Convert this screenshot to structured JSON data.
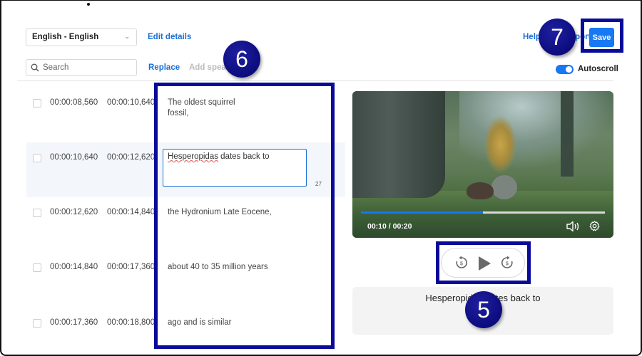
{
  "toolbar": {
    "language_select": {
      "value": "English - English",
      "icon": "chevron-down-icon"
    },
    "edit_details_label": "Edit details",
    "help_label": "Help",
    "export_label": "Export",
    "save_label": "Save",
    "search": {
      "placeholder": "Search",
      "value": "",
      "icon": "search-icon"
    },
    "replace_label": "Replace",
    "add_speaker_label": "Add speaker",
    "autoscroll": {
      "label": "Autoscroll",
      "enabled": true
    }
  },
  "captions": [
    {
      "start": "00:00:08,560",
      "end": "00:00:10,640",
      "text_line1": "The oldest squirrel",
      "text_line2": "fossil,"
    },
    {
      "start": "00:00:10,640",
      "end": "00:00:12,620",
      "text": "Hesperopidas dates back to",
      "char_count": "27",
      "editing": true
    },
    {
      "start": "00:00:12,620",
      "end": "00:00:14,840",
      "text": "the Hydronium Late Eocene,"
    },
    {
      "start": "00:00:14,840",
      "end": "00:00:17,360",
      "text": "about 40 to 35 million years"
    },
    {
      "start": "00:00:17,360",
      "end": "00:00:18,800",
      "text": "ago and is similar"
    }
  ],
  "player": {
    "time_display": "00:10 / 00:20",
    "progress_fraction": 0.5,
    "icons": [
      "volume-icon",
      "settings-gear-icon"
    ],
    "controls": {
      "rewind": "rewind-5-icon",
      "play": "play-icon",
      "forward": "forward-5-icon",
      "skip_seconds": "5"
    }
  },
  "caption_preview": {
    "text": "Hesperopidas dates back to"
  },
  "annotations": {
    "badge_5": "5",
    "badge_6": "6",
    "badge_7": "7",
    "highlight_color": "#0a0a9a"
  },
  "colors": {
    "accent": "#1877f2",
    "link": "#1a6fd6",
    "active_row": "#f3f7fc"
  }
}
